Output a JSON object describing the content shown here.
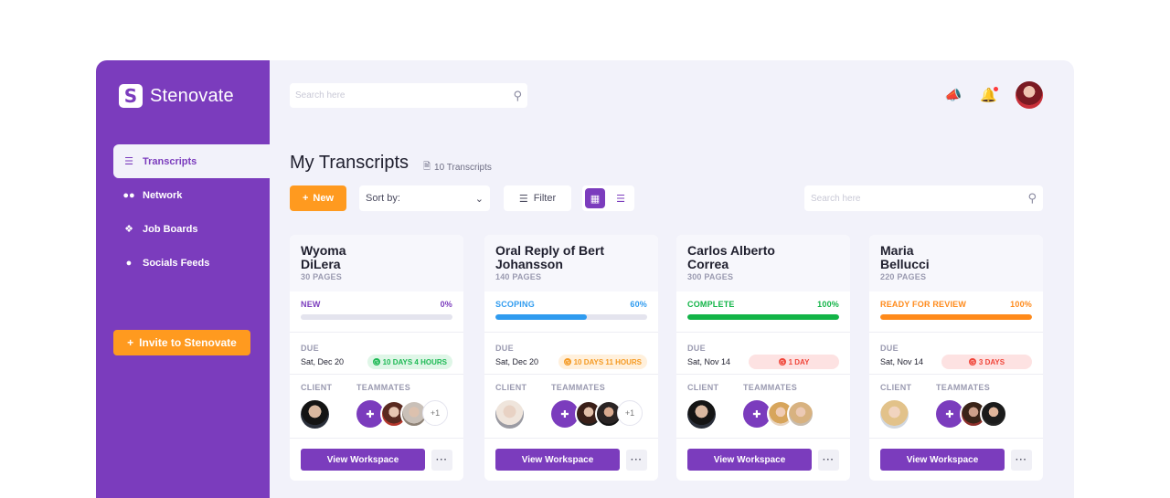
{
  "brand": {
    "name": "Stenovate",
    "logo_letter": "S"
  },
  "sidebar": {
    "items": [
      {
        "label": "Transcripts",
        "icon": "stack-icon",
        "active": true
      },
      {
        "label": "Network",
        "icon": "people-icon"
      },
      {
        "label": "Job Boards",
        "icon": "pin-icon"
      },
      {
        "label": "Socials Feeds",
        "icon": "chat-icon"
      }
    ],
    "invite_label": "Invite to Stenovate"
  },
  "topbar": {
    "search_placeholder": "Search here"
  },
  "page": {
    "title": "My Transcripts",
    "count_label": "10 Transcripts",
    "new_label": "New",
    "sort_label": "Sort by:",
    "filter_label": "Filter",
    "search_placeholder": "Search here"
  },
  "labels": {
    "due": "DUE",
    "client": "CLIENT",
    "teammates": "TEAMMATES",
    "view_workspace": "View Workspace",
    "more": "···"
  },
  "cards": [
    {
      "title_line1": "Wyoma",
      "title_line2": "DiLera",
      "pages": "30 PAGES",
      "status": "NEW",
      "percent": "0%",
      "progress": 0,
      "status_color": "#7b3cbd",
      "due_date": "Sat, Dec 20",
      "badge": "10 DAYS  4 HOURS",
      "badge_color": "#1db954",
      "badge_bg": "#dff6e7",
      "extra_mates": "+1"
    },
    {
      "title_line1": "Oral Reply of Bert",
      "title_line2": "Johansson",
      "pages": "140 PAGES",
      "status": "SCOPING",
      "percent": "60%",
      "progress": 60,
      "status_color": "#2f9bef",
      "due_date": "Sat, Dec 20",
      "badge": "10 DAYS  11 HOURS",
      "badge_color": "#f59a23",
      "badge_bg": "#fff0dc",
      "extra_mates": "+1"
    },
    {
      "title_line1": "Carlos Alberto",
      "title_line2": "Correa",
      "pages": "300 PAGES",
      "status": "COMPLETE",
      "percent": "100%",
      "progress": 100,
      "status_color": "#12b447",
      "due_date": "Sat, Nov 14",
      "badge": "1 DAY",
      "badge_color": "#f04438",
      "badge_bg": "#fde2e2"
    },
    {
      "title_line1": "Maria",
      "title_line2": "Bellucci",
      "pages": "220 PAGES",
      "status": "READY FOR REVIEW",
      "percent": "100%",
      "progress": 100,
      "status_color": "#ff8a1a",
      "due_date": "Sat, Nov 14",
      "badge": "3 DAYS",
      "badge_color": "#f04438",
      "badge_bg": "#fde2e2"
    }
  ]
}
